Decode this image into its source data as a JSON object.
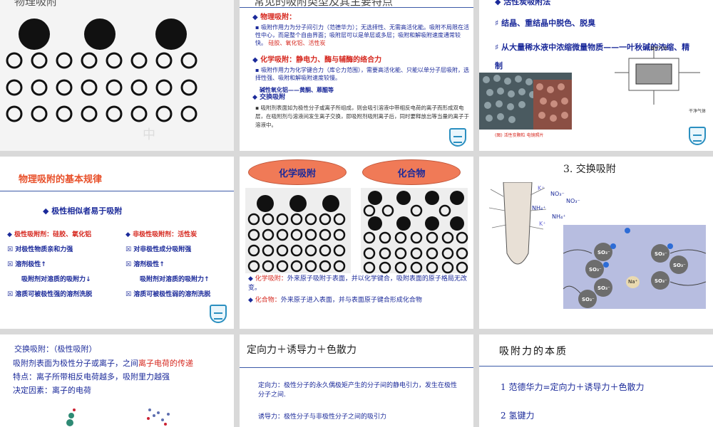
{
  "slides": {
    "s1": {
      "title_cut": "物理吸附"
    },
    "s2": {
      "title_cut": "常见的吸附类型及其主要特点",
      "physical_head": "物理吸附：",
      "physical_body": "吸附作用力为分子间引力（范德华力）；无选择性、无需高活化能。吸附不局限在活性中心，而是整个自由界面；吸附层可以是单层或多层；吸附和解吸附速度通常较快。",
      "physical_examples": "硅胶、氧化铝、活性炭",
      "chemical_head": "化学吸附：静电力、酶与辅酶的络合力",
      "chemical_body": "吸附作用力为化学键合力（库仑力范围），需要高活化能、只能以单分子层吸附，选择性强、吸附和解吸附速度较慢。",
      "chemical_examples": "碱性氧化铝——黄酮、蒽醌等",
      "exchange_head": "交换吸附",
      "exchange_body": "吸附剂表面如为极性分子或离子所组成，则会吸引溶液中带相反电荷的离子而形成双电层，在吸附剂与溶液间发生离子交换，即吸附剂吸附离子后，同时要释放出等当量的离子于溶液中。"
    },
    "s3": {
      "title_cut": "活性炭吸附法",
      "item1": "结晶、重结晶中脱色、脱臭",
      "item2": "从大量稀水液中浓缩微量物质——一叶秋碱的浓缩、精制",
      "caption": "(图) 活性炭颗粒 电镜照片",
      "diagram_label1": "载性气体",
      "diagram_label2": "干净气体"
    },
    "s4": {
      "title": "物理吸附的基本规律",
      "rule": "极性相似者易于吸附",
      "left": [
        "极性吸附剂：硅胶、氧化铝",
        "对极性物质亲和力强",
        "溶剂极性↑",
        "吸附剂对溶质的吸附力↓",
        "溶质可被极性强的溶剂洗脱"
      ],
      "right": [
        "非极性吸附剂：活性炭",
        "对非极性成分吸附强",
        "溶剂极性↑",
        "吸附剂对溶质的吸附力↑",
        "溶质可被极性弱的溶剂洗脱"
      ]
    },
    "s5": {
      "oval1": "化学吸附",
      "oval2": "化合物",
      "note1_head": "化学吸附：",
      "note1_body": "外来原子吸附于表面，并以化学键合，吸附表面的原子格局无改变。",
      "note2_head": "化合物：",
      "note2_body": "外来原子进入表面，并与表面原子键合形成化合物"
    },
    "s6": {
      "title": "3. 交换吸附",
      "ions": [
        "K⁺",
        "NO₃⁻",
        "NO₃⁻",
        "NH₄⁺",
        "NH₄⁺",
        "K⁺"
      ],
      "so3": [
        "SO₃⁻",
        "SO₃⁻",
        "SO₃⁻",
        "SO₃⁻",
        "SO₃⁻",
        "SO₃⁻",
        "SO₃⁻"
      ],
      "na": "Na⁺"
    },
    "s7": {
      "line1": "交换吸附：（极性吸附）",
      "line2a": "吸附剂表面为极性分子或离子，之间",
      "line2b": "离子电荷的传递",
      "line3": "特点：离子所带相反电荷越多，吸附里力越强",
      "line4": "决定因素：离子的电荷"
    },
    "s8": {
      "title": "定向力＋诱导力＋色散力",
      "p1": "定向力：极性分子的永久偶极矩产生的分子间的静电引力，发生在极性分子之间.",
      "p2": "诱导力：极性分子与非极性分子之间的吸引力"
    },
    "s9": {
      "title": "吸附力的本质",
      "line1": "1 范德华力=定向力＋诱导力＋色散力",
      "line2": "2 氢键力"
    }
  }
}
